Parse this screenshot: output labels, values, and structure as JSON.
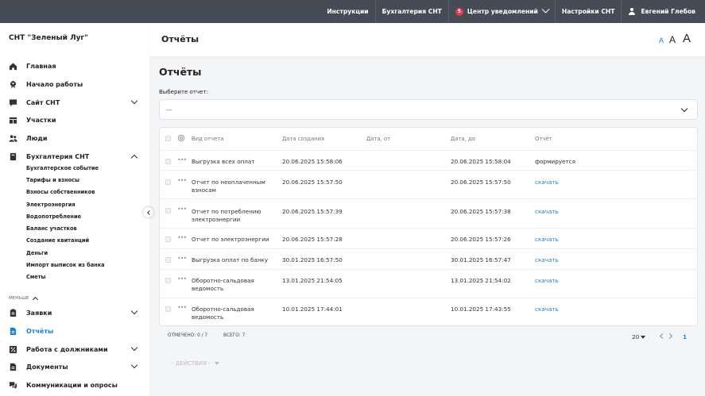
{
  "topbar": {
    "instructions": "Инструкции",
    "accounting": "Бухгалтерия СНТ",
    "notif_count": "5",
    "notifications": "Центр уведомлений",
    "settings": "Настройки СНТ",
    "user": "Евгений Глебов"
  },
  "sidebar": {
    "org": "СНТ \"Зеленый Луг\"",
    "items": [
      {
        "label": "Главная",
        "icon": "home-icon"
      },
      {
        "label": "Начало работы",
        "icon": "rocket-icon"
      },
      {
        "label": "Сайт СНТ",
        "icon": "chat-icon"
      },
      {
        "label": "Участки",
        "icon": "grid-icon"
      },
      {
        "label": "Люди",
        "icon": "people-icon"
      },
      {
        "label": "Бухгалтерия СНТ",
        "icon": "book-icon"
      }
    ],
    "sub_items": [
      "Бухгалтерское событие",
      "Тарифы и взносы",
      "Взносы собственников",
      "Электроэнергия",
      "Водопотребление",
      "Баланс участков",
      "Создание квитанций",
      "Деньги",
      "Импорт выписок из банка",
      "Сметы"
    ],
    "less": "МЕНЬШЕ",
    "items2": [
      {
        "label": "Заявки",
        "icon": "clipboard-icon"
      },
      {
        "label": "Отчёты",
        "icon": "report-icon"
      },
      {
        "label": "Работа с должниками",
        "icon": "percent-icon"
      },
      {
        "label": "Документы",
        "icon": "document-icon"
      },
      {
        "label": "Коммуникации и опросы",
        "icon": "comments-icon"
      }
    ]
  },
  "header": {
    "title": "Отчёты",
    "font_small": "A",
    "font_medium": "A",
    "font_large": "A"
  },
  "page": {
    "heading": "Отчёты",
    "select_label": "Выберите отчет:",
    "select_value": "---"
  },
  "table": {
    "columns": [
      "Вид отчета",
      "Дата создания",
      "Дата, от",
      "Дата, до",
      "Отчёт"
    ],
    "rows": [
      {
        "type": "Выгрузка всех оплат",
        "created": "20.06.2025 15:58:06",
        "from": "",
        "to": "20.06.2025 15:58:04",
        "report": "формируется"
      },
      {
        "type": "Отчет по неоплаченным взносам",
        "created": "20.06.2025 15:57:50",
        "from": "",
        "to": "20.06.2025 15:57:50",
        "report": "скачать"
      },
      {
        "type": "Отчет по потреблению электроэнергии",
        "created": "20.06.2025 15:57:39",
        "from": "",
        "to": "20.06.2025 15:57:38",
        "report": "скачать"
      },
      {
        "type": "Отчет по электроэнергии",
        "created": "20.06.2025 15:57:28",
        "from": "",
        "to": "20.06.2025 15:57:26",
        "report": "скачать"
      },
      {
        "type": "Выгрузка оплат по банку",
        "created": "30.01.2025 16:57:50",
        "from": "",
        "to": "30.01.2025 16:57:47",
        "report": "скачать"
      },
      {
        "type": "Оборотно-сальдовая ведомость",
        "created": "13.01.2025 21:54:05",
        "from": "",
        "to": "13.01.2025 21:54:02",
        "report": "скачать"
      },
      {
        "type": "Оборотно-сальдовая ведомость",
        "created": "10.01.2025 17:44:01",
        "from": "",
        "to": "10.01.2025 17:43:55",
        "report": "скачать"
      }
    ],
    "marked": "ОТМЕЧЕНО: 0 / 7",
    "total": "ВСЕГО: 7",
    "per_page": "20",
    "page": "1"
  },
  "actions_label": "- ДЕЙСТВИЯ -",
  "colors": {
    "topbar": "#454c55",
    "accent": "#1e7fd6",
    "badge": "#e53b4b"
  }
}
